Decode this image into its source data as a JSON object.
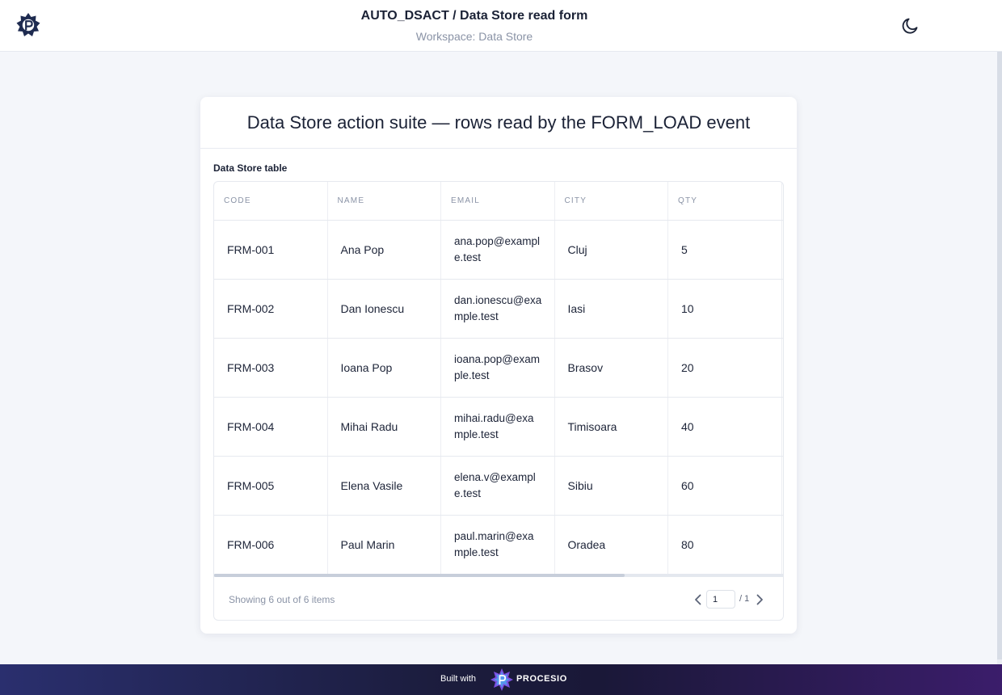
{
  "header": {
    "title": "AUTO_DSACT / Data Store read form",
    "subtitle": "Workspace: Data Store",
    "logo_icon": "procesio-gear-logo-icon",
    "theme_icon": "moon-icon"
  },
  "card": {
    "title": "Data Store action suite — rows read by the FORM_LOAD event",
    "table_label": "Data Store table"
  },
  "table": {
    "columns": [
      "CODE",
      "NAME",
      "EMAIL",
      "CITY",
      "QTY"
    ],
    "rows": [
      [
        "FRM-001",
        "Ana Pop",
        "ana.pop@example.test",
        "Cluj",
        "5"
      ],
      [
        "FRM-002",
        "Dan Ionescu",
        "dan.ionescu@example.test",
        "Iasi",
        "10"
      ],
      [
        "FRM-003",
        "Ioana Pop",
        "ioana.pop@example.test",
        "Brasov",
        "20"
      ],
      [
        "FRM-004",
        "Mihai Radu",
        "mihai.radu@example.test",
        "Timisoara",
        "40"
      ],
      [
        "FRM-005",
        "Elena Vasile",
        "elena.v@example.test",
        "Sibiu",
        "60"
      ],
      [
        "FRM-006",
        "Paul Marin",
        "paul.marin@example.test",
        "Oradea",
        "80"
      ]
    ],
    "horizontal_scroll_fraction": 0.72
  },
  "pagination": {
    "showing_text": "Showing 6 out of 6 items",
    "current_page": "1",
    "total_pages_text": "/ 1",
    "prev_icon": "chevron-left-icon",
    "next_icon": "chevron-right-icon"
  },
  "footer": {
    "built_with": "Built with",
    "brand": "PROCESIO",
    "brand_icon": "procesio-star-logo-icon"
  },
  "colors": {
    "background": "#f4f6fa",
    "card": "#ffffff",
    "text": "#1d2438",
    "muted": "#8a93a6",
    "footer_start": "#2a2f6e",
    "footer_end": "#3b1d6b"
  }
}
